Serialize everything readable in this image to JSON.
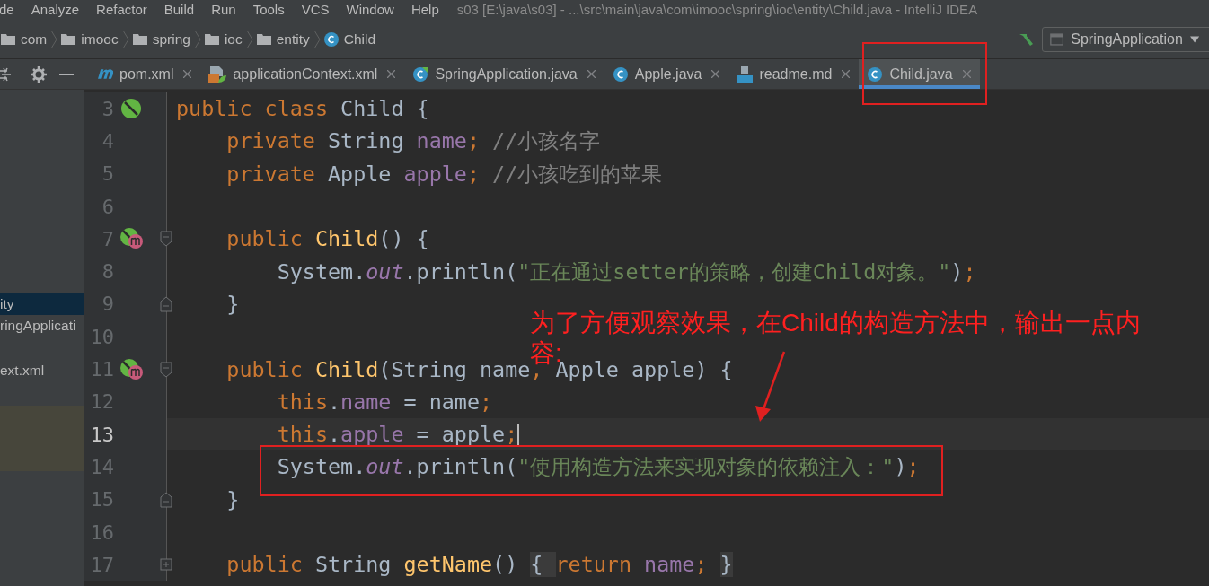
{
  "menu": [
    "de",
    "Analyze",
    "Refactor",
    "Build",
    "Run",
    "Tools",
    "VCS",
    "Window",
    "Help"
  ],
  "window": {
    "title": "s03 [E:\\java\\s03] - ...\\src\\main\\java\\com\\imooc\\spring\\ioc\\entity\\Child.java - IntelliJ IDEA"
  },
  "breadcrumbs": [
    {
      "label": "com",
      "kind": "folder"
    },
    {
      "label": "imooc",
      "kind": "folder"
    },
    {
      "label": "spring",
      "kind": "folder"
    },
    {
      "label": "ioc",
      "kind": "folder"
    },
    {
      "label": "entity",
      "kind": "folder"
    },
    {
      "label": "Child",
      "kind": "class"
    }
  ],
  "run_config": "SpringApplication",
  "tabs": [
    {
      "label": "pom.xml",
      "kind": "maven",
      "selected": false
    },
    {
      "label": "applicationContext.xml",
      "kind": "xml",
      "selected": false
    },
    {
      "label": "SpringApplication.java",
      "kind": "spring",
      "selected": false
    },
    {
      "label": "Apple.java",
      "kind": "class",
      "selected": false
    },
    {
      "label": "readme.md",
      "kind": "md",
      "selected": false
    },
    {
      "label": "Child.java",
      "kind": "class",
      "selected": true
    }
  ],
  "project_items": [
    {
      "label": "ity",
      "selected": true
    },
    {
      "label": "ringApplicati",
      "selected": false
    },
    {
      "label": "ext.xml",
      "selected": false
    }
  ],
  "lines": [
    {
      "number": "3",
      "current": false,
      "kind": "class",
      "tokens": [
        {
          "kind": "kw",
          "text": "public class "
        },
        {
          "kind": "p",
          "text": "Child {"
        }
      ]
    },
    {
      "number": "4",
      "current": false,
      "kind": "plain",
      "tokens": [
        {
          "kind": "kw",
          "text": "    private "
        },
        {
          "kind": "p",
          "text": "String "
        },
        {
          "kind": "f",
          "text": "name"
        },
        {
          "kind": "kw",
          "text": "; "
        },
        {
          "kind": "c",
          "text": "//小孩名字"
        }
      ]
    },
    {
      "number": "5",
      "current": false,
      "kind": "plain",
      "tokens": [
        {
          "kind": "kw",
          "text": "    private "
        },
        {
          "kind": "p",
          "text": "Apple "
        },
        {
          "kind": "f",
          "text": "apple"
        },
        {
          "kind": "kw",
          "text": "; "
        },
        {
          "kind": "c",
          "text": "//小孩吃到的苹果"
        }
      ]
    },
    {
      "number": "6",
      "current": false,
      "kind": "plain"
    },
    {
      "number": "7",
      "current": false,
      "kind": "method",
      "tokens": [
        {
          "kind": "kw",
          "text": "    public "
        },
        {
          "kind": "m",
          "text": "Child"
        },
        {
          "kind": "p",
          "text": "() {"
        }
      ]
    },
    {
      "number": "8",
      "current": false,
      "kind": "plain",
      "tokens": [
        {
          "kind": "p",
          "text": "        System."
        },
        {
          "kind": "s",
          "text": "out"
        },
        {
          "kind": "p",
          "text": ".println("
        },
        {
          "kind": "str",
          "text": "\"正在通过setter的策略，创建Child对象。\""
        },
        {
          "kind": "p",
          "text": ")"
        },
        {
          "kind": "kw",
          "text": ";"
        }
      ]
    },
    {
      "number": "9",
      "current": false,
      "kind": "block-end",
      "tokens": [
        {
          "kind": "p",
          "text": "    }"
        }
      ]
    },
    {
      "number": "10",
      "current": false,
      "kind": "plain"
    },
    {
      "number": "11",
      "current": false,
      "kind": "method",
      "tokens": [
        {
          "kind": "kw",
          "text": "    public "
        },
        {
          "kind": "m",
          "text": "Child"
        },
        {
          "kind": "p",
          "text": "(String name"
        },
        {
          "kind": "kw",
          "text": ", "
        },
        {
          "kind": "p",
          "text": "Apple apple) {"
        }
      ]
    },
    {
      "number": "12",
      "current": false,
      "kind": "plain",
      "tokens": [
        {
          "kind": "kw",
          "text": "        this"
        },
        {
          "kind": "p",
          "text": "."
        },
        {
          "kind": "f",
          "text": "name "
        },
        {
          "kind": "p",
          "text": "= name"
        },
        {
          "kind": "kw",
          "text": ";"
        }
      ]
    },
    {
      "number": "13",
      "current": true,
      "kind": "plain",
      "tokens": [
        {
          "kind": "kw",
          "text": "        this"
        },
        {
          "kind": "p",
          "text": "."
        },
        {
          "kind": "f",
          "text": "apple "
        },
        {
          "kind": "p",
          "text": "= apple"
        },
        {
          "kind": "kw",
          "text": ";"
        }
      ]
    },
    {
      "number": "14",
      "current": false,
      "kind": "plain",
      "tokens": [
        {
          "kind": "p",
          "text": "        System."
        },
        {
          "kind": "s",
          "text": "out"
        },
        {
          "kind": "p",
          "text": ".println("
        },
        {
          "kind": "str",
          "text": "\"使用构造方法来实现对象的依赖注入：\""
        },
        {
          "kind": "p",
          "text": ")"
        },
        {
          "kind": "kw",
          "text": ";"
        }
      ]
    },
    {
      "number": "15",
      "current": false,
      "kind": "block-end",
      "tokens": [
        {
          "kind": "p",
          "text": "    }"
        }
      ]
    },
    {
      "number": "16",
      "current": false,
      "kind": "plain"
    },
    {
      "number": "17",
      "current": false,
      "kind": "folded",
      "tokens": [
        {
          "kind": "kw",
          "text": "    public "
        },
        {
          "kind": "p",
          "text": "String "
        },
        {
          "kind": "m",
          "text": "getName"
        },
        {
          "kind": "p",
          "text": "() "
        },
        {
          "kind": "fold",
          "text": "{ "
        },
        {
          "kind": "kw",
          "text": "return "
        },
        {
          "kind": "f",
          "text": "name"
        },
        {
          "kind": "kw",
          "text": "; "
        },
        {
          "kind": "fold",
          "text": "}"
        }
      ]
    }
  ],
  "annotation": {
    "text": "为了方便观察效果，在Child的构造方法中，输出一点内容:"
  }
}
